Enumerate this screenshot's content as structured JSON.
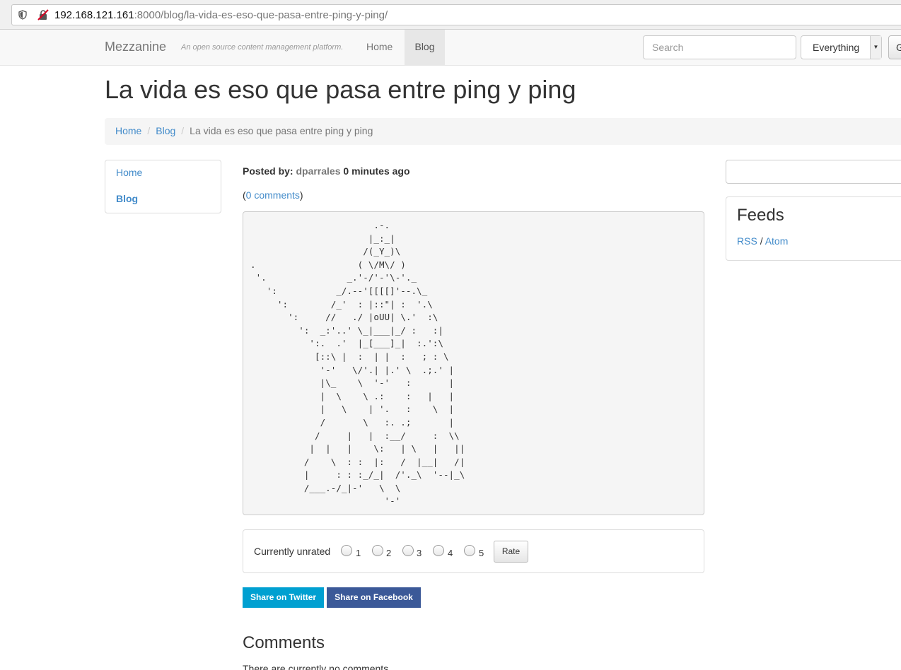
{
  "browser": {
    "url_host": "192.168.121.161",
    "url_path": ":8000/blog/la-vida-es-eso-que-pasa-entre-ping-y-ping/"
  },
  "navbar": {
    "brand": "Mezzanine",
    "tagline": "An open source content management platform.",
    "nav_home": "Home",
    "nav_blog": "Blog",
    "search_placeholder": "Search",
    "search_scope": "Everything",
    "go_label": "Go"
  },
  "page": {
    "title": "La vida es eso que pasa entre ping y ping"
  },
  "breadcrumb": {
    "home": "Home",
    "blog": "Blog",
    "current": "La vida es eso que pasa entre ping y ping"
  },
  "leftnav": {
    "items": [
      {
        "label": "Home",
        "active": false
      },
      {
        "label": "Blog",
        "active": true
      }
    ]
  },
  "post": {
    "posted_by_label": "Posted by:",
    "author": "dparrales",
    "time_ago": "0 minutes ago",
    "comments_link": "0 comments",
    "ascii_art": "                       .-.\n                      |_:_|\n                     /(_Y_)\\\n.                   ( \\/M\\/ )\n '.               _.'-/'-'\\-'._\n   ':           _/.--'[[[[]'--.\\_\n     ':        /_'  : |::\"| :  '.\\\n       ':     //   ./ |oUU| \\.'  :\\\n         ':  _:'..' \\_|___|_/ :   :|\n           ':.  .'  |_[___]_|  :.':\\\n            [::\\ |  :  | |  :   ; : \\\n             '-'   \\/'.| |.' \\  .;.' |\n             |\\_    \\  '-'   :       |\n             |  \\    \\ .:    :   |   |\n             |   \\    | '.   :    \\  |\n             /       \\   :. .;       |\n            /     |   |  :__/     :  \\\\\n           |  |   |    \\:   | \\   |   ||\n          /    \\  : :  |:   /  |__|   /|\n          |     : : :_/_|  /'._\\  '--|_\\\n          /___.-/_|-'   \\  \\\n                         '-'"
  },
  "rating": {
    "label": "Currently unrated",
    "options": [
      "1",
      "2",
      "3",
      "4",
      "5"
    ],
    "button": "Rate"
  },
  "share": {
    "twitter": "Share on Twitter",
    "facebook": "Share on Facebook"
  },
  "comments": {
    "heading": "Comments",
    "empty_text": "There are currently no comments"
  },
  "sidebar": {
    "feeds_title": "Feeds",
    "rss": "RSS",
    "separator": "/",
    "atom": "Atom"
  },
  "colors": {
    "link": "#428bca",
    "twitter": "#00a0d1",
    "facebook": "#3b5998"
  }
}
